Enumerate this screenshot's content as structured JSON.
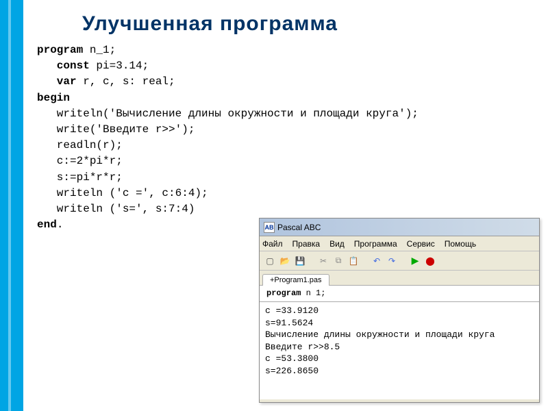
{
  "title": "Улучшенная программа",
  "code": {
    "l1a": "program",
    "l1b": " n_1;",
    "l2a": "   const",
    "l2b": " pi=3.14;",
    "l3a": "   var",
    "l3b": " r, c, s: real;",
    "l4a": "begin",
    "l5": "   writeln('Вычисление длины окружности и площади круга');",
    "l6": "   write('Введите r>>');",
    "l7": "   readln(r);",
    "l8": "   c:=2*pi*r;",
    "l9": "   s:=pi*r*r;",
    "l10": "   writeln ('c =', c:6:4);",
    "l11": "   writeln ('s=', s:7:4)",
    "l12a": "end",
    "l12b": "."
  },
  "pascal": {
    "title": "Pascal ABC",
    "icon": "АВ",
    "menu": {
      "file": "Файл",
      "edit": "Правка",
      "view": "Вид",
      "program": "Программа",
      "service": "Сервис",
      "help": "Помощь"
    },
    "tab": "+Program1.pas",
    "editor_kw": "program",
    "editor_rest": " n 1;",
    "output": "c =33.9120\ns=91.5624\nВычисление длины окружности и площади круга\nВведите r>>8.5\nc =53.3800\ns=226.8650"
  }
}
